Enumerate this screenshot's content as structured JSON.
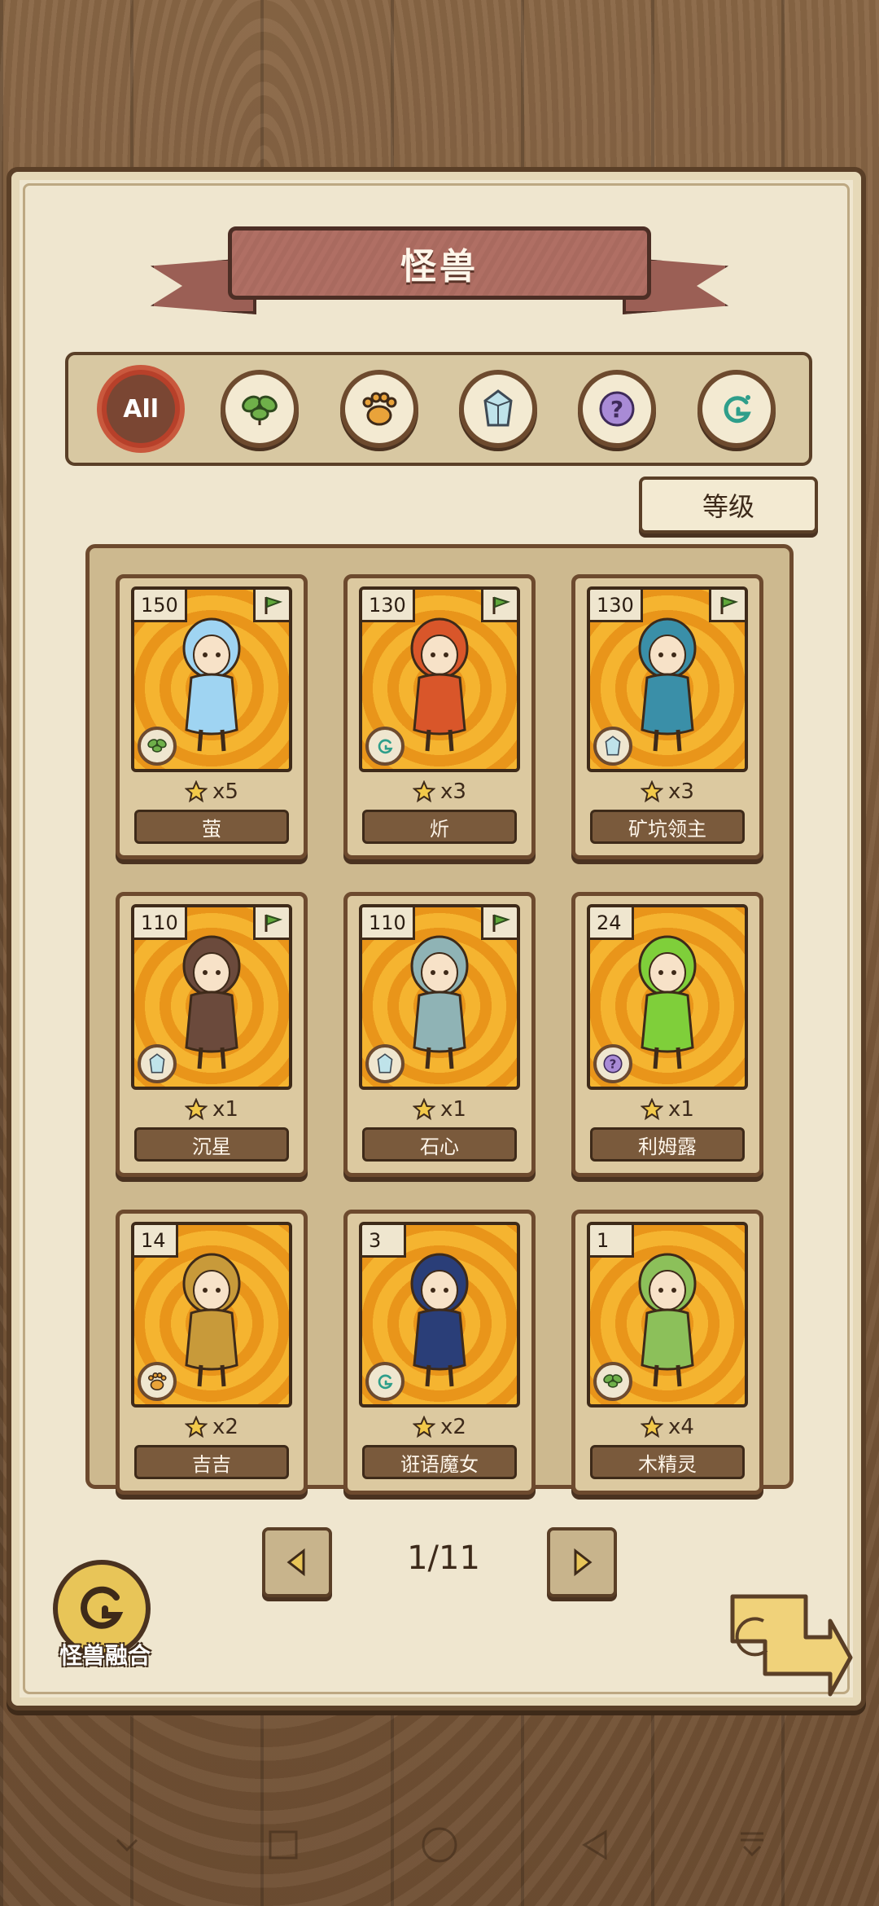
{
  "title": "怪兽",
  "filters": [
    {
      "id": "all",
      "label": "All",
      "icon": "all-icon",
      "active": true
    },
    {
      "id": "plant",
      "icon": "leaf-icon",
      "active": false
    },
    {
      "id": "beast",
      "icon": "paw-icon",
      "active": false
    },
    {
      "id": "mineral",
      "icon": "crystal-icon",
      "active": false
    },
    {
      "id": "unknown",
      "icon": "question-icon",
      "active": false
    },
    {
      "id": "magic",
      "icon": "swirl-icon",
      "active": false
    }
  ],
  "sort_label": "等级",
  "monsters": [
    {
      "name": "萤",
      "level": "150",
      "stars": "x5",
      "element": "leaf-icon",
      "flag": true,
      "color": "#9fd4f2"
    },
    {
      "name": "炘",
      "level": "130",
      "stars": "x3",
      "element": "swirl-icon",
      "flag": true,
      "color": "#d9562a"
    },
    {
      "name": "矿坑领主",
      "level": "130",
      "stars": "x3",
      "element": "crystal-icon",
      "flag": true,
      "color": "#3a8fa8"
    },
    {
      "name": "沉星",
      "level": "110",
      "stars": "x1",
      "element": "crystal-icon",
      "flag": true,
      "color": "#6b4a3c"
    },
    {
      "name": "石心",
      "level": "110",
      "stars": "x1",
      "element": "crystal-icon",
      "flag": true,
      "color": "#8fb3b5"
    },
    {
      "name": "利姆露",
      "level": "24",
      "stars": "x1",
      "element": "question-icon",
      "flag": false,
      "color": "#7fcf3a"
    },
    {
      "name": "吉吉",
      "level": "14",
      "stars": "x2",
      "element": "paw-icon",
      "flag": false,
      "color": "#c89a3a"
    },
    {
      "name": "诳语魔女",
      "level": "3",
      "stars": "x2",
      "element": "swirl-icon",
      "flag": false,
      "color": "#2a3e78"
    },
    {
      "name": "木精灵",
      "level": "1",
      "stars": "x4",
      "element": "leaf-icon",
      "flag": false,
      "color": "#8cc05a"
    }
  ],
  "pager": {
    "text": "1/11"
  },
  "fusion_label": "怪兽融合",
  "colors": {
    "accent": "#c9583d",
    "parchment": "#efe6cf",
    "wood": "#7a5a3c"
  }
}
